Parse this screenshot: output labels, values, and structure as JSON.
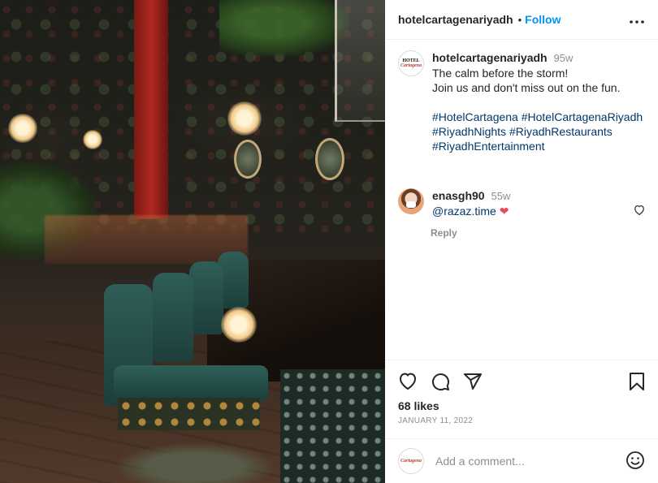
{
  "post": {
    "author": "hotelcartagenariyadh",
    "separator": "•",
    "follow_label": "Follow",
    "more_label": "•••",
    "avatar_logo_top": "HOTEL",
    "avatar_logo_script": "Cartagena"
  },
  "caption": {
    "author": "hotelcartagenariyadh",
    "time": "95w",
    "lines": [
      "The calm before the storm!",
      "Join us and don't miss out on the fun."
    ],
    "hashtags": [
      "#HotelCartagena #HotelCartagenaRiyadh",
      "#RiyadhNights #RiyadhRestaurants",
      "#RiyadhEntertainment"
    ]
  },
  "comments": [
    {
      "author": "enasgh90",
      "time": "55w",
      "mention": "@razaz.time",
      "emoji": "❤",
      "reply_label": "Reply"
    }
  ],
  "actions": {
    "like_icon": "heart-icon",
    "comment_icon": "comment-icon",
    "share_icon": "send-icon",
    "save_icon": "bookmark-icon"
  },
  "stats": {
    "likes": "68 likes",
    "date": "JANUARY 11, 2022"
  },
  "add_comment": {
    "placeholder": "Add a comment...",
    "emoji_icon": "smiley-icon"
  }
}
